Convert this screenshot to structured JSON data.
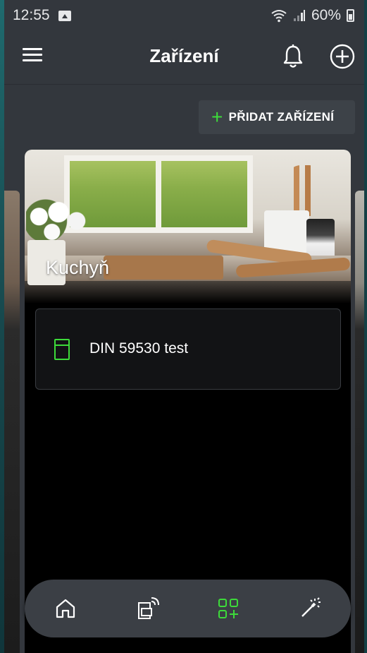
{
  "status_bar": {
    "time": "12:55",
    "battery": "60%",
    "icons": [
      "gallery-icon",
      "wifi-icon",
      "signal-icon",
      "battery-icon"
    ]
  },
  "header": {
    "title": "Zařízení",
    "menu_icon": "menu-icon",
    "notifications_icon": "bell-icon",
    "add_icon": "add-circle-icon"
  },
  "toolbar": {
    "add_device_label": "PŘIDAT ZAŘÍZENÍ",
    "add_device_icon": "plus-icon"
  },
  "room": {
    "name": "Kuchyň",
    "devices": [
      {
        "name": "DIN 59530 test",
        "icon": "device-icon"
      }
    ]
  },
  "bottom_nav": {
    "items": [
      {
        "id": "home",
        "icon": "home-icon",
        "active": false
      },
      {
        "id": "remote-devices",
        "icon": "remote-devices-icon",
        "active": false
      },
      {
        "id": "devices",
        "icon": "add-device-grid-icon",
        "active": true
      },
      {
        "id": "scenes",
        "icon": "magic-wand-icon",
        "active": false
      }
    ]
  },
  "colors": {
    "accent": "#3ddb3a",
    "background": "#33373d",
    "card": "#000000",
    "nav": "#3b3f45"
  }
}
